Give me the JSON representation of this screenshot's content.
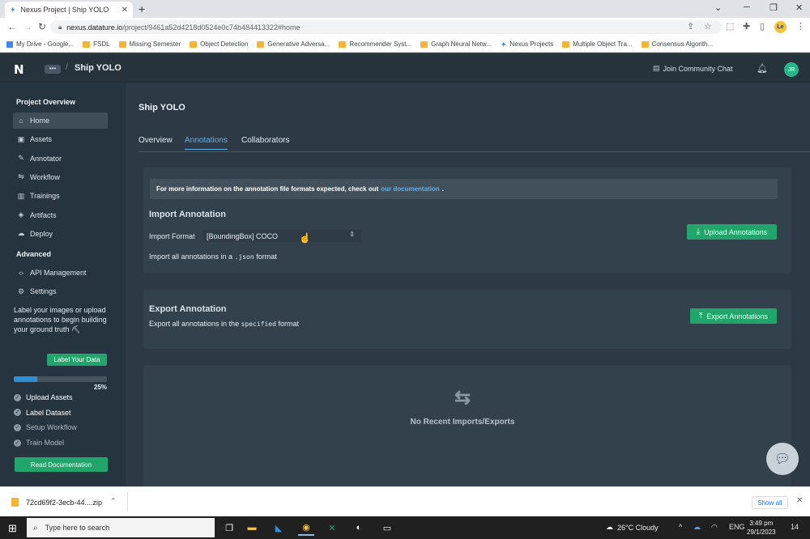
{
  "browser": {
    "tab_title": "Nexus Project | Ship YOLO",
    "url_host": "nexus.datature.io",
    "url_path": "/project/9461a52d4218d0524e0c74b484413322#home",
    "bookmarks": [
      {
        "label": "My Drive - Google...",
        "icon": "drive-icon"
      },
      {
        "label": "FSDL",
        "icon": "folder-icon"
      },
      {
        "label": "Missing Semester",
        "icon": "folder-icon"
      },
      {
        "label": "Object Detection",
        "icon": "folder-icon"
      },
      {
        "label": "Generative Adversa...",
        "icon": "folder-icon"
      },
      {
        "label": "Recommender Syst...",
        "icon": "folder-icon"
      },
      {
        "label": "Graph Neural Netw...",
        "icon": "folder-icon"
      },
      {
        "label": "Nexus Projects",
        "icon": "nexus-icon"
      },
      {
        "label": "Multiple Object Tra...",
        "icon": "folder-icon"
      },
      {
        "label": "Consensus Algorith...",
        "icon": "folder-icon"
      }
    ],
    "profile_initials": "Le"
  },
  "app": {
    "logo": "N",
    "breadcrumb_dots": "•••",
    "breadcrumb_sep": "/",
    "project_name": "Ship YOLO",
    "community_chat": "Join Community Chat",
    "avatar_initials": "JR"
  },
  "sidebar": {
    "heading_overview": "Project Overview",
    "items_overview": [
      {
        "label": "Home",
        "icon": "home-icon",
        "glyph": "⌂",
        "active": true
      },
      {
        "label": "Assets",
        "icon": "image-icon",
        "glyph": "▣"
      },
      {
        "label": "Annotator",
        "icon": "annotator-icon",
        "glyph": "✎"
      },
      {
        "label": "Workflow",
        "icon": "workflow-icon",
        "glyph": "⇋"
      },
      {
        "label": "Trainings",
        "icon": "chart-icon",
        "glyph": "▥"
      },
      {
        "label": "Artifacts",
        "icon": "cube-icon",
        "glyph": "◈"
      },
      {
        "label": "Deploy",
        "icon": "deploy-icon",
        "glyph": "☁"
      }
    ],
    "heading_advanced": "Advanced",
    "items_advanced": [
      {
        "label": "API Management",
        "icon": "code-icon",
        "glyph": "‹›"
      },
      {
        "label": "Settings",
        "icon": "gear-icon",
        "glyph": "⚙"
      }
    ],
    "note": "Label your images or upload annotations to begin building your ground truth ⛏",
    "label_button": "Label Your Data",
    "progress_percent": 25,
    "progress_label": "25%",
    "steps": [
      {
        "label": "Upload Assets",
        "done": true
      },
      {
        "label": "Label Dataset",
        "done": true
      },
      {
        "label": "Setup Workflow",
        "done": false
      },
      {
        "label": "Train Model",
        "done": false
      }
    ],
    "docs_button": "Read Documentation"
  },
  "main": {
    "title": "Ship YOLO",
    "tabs": [
      {
        "label": "Overview",
        "active": false
      },
      {
        "label": "Annotations",
        "active": true
      },
      {
        "label": "Collaborators",
        "active": false
      }
    ],
    "info_text": "For more information on the annotation file formats expected, check out",
    "info_link": "our documentation",
    "info_end": ".",
    "import": {
      "title": "Import Annotation",
      "format_label": "Import Format",
      "format_value": "[BoundingBox] COCO",
      "desc_before": "Import all annotations in a",
      "desc_code": ".json",
      "desc_after": "format",
      "button": "Upload Annotations"
    },
    "export": {
      "title": "Export Annotation",
      "desc_before": "Export all annotations in the",
      "desc_code": "specified",
      "desc_after": "format",
      "button": "Export Annotations"
    },
    "empty_text": "No Recent Imports/Exports"
  },
  "downloads": {
    "file_name": "72cd69f2-3ecb-44....zip",
    "show_all": "Show all"
  },
  "taskbar": {
    "search_placeholder": "Type here to search",
    "weather": "26°C  Cloudy",
    "language": "ENG",
    "time": "3:49 pm",
    "date": "29/1/2023",
    "notification_count": "14"
  },
  "colors": {
    "accent_green": "#22a56b",
    "accent_blue": "#5fb0ea",
    "sidebar_bg": "#263440",
    "card_bg": "#33414d"
  }
}
